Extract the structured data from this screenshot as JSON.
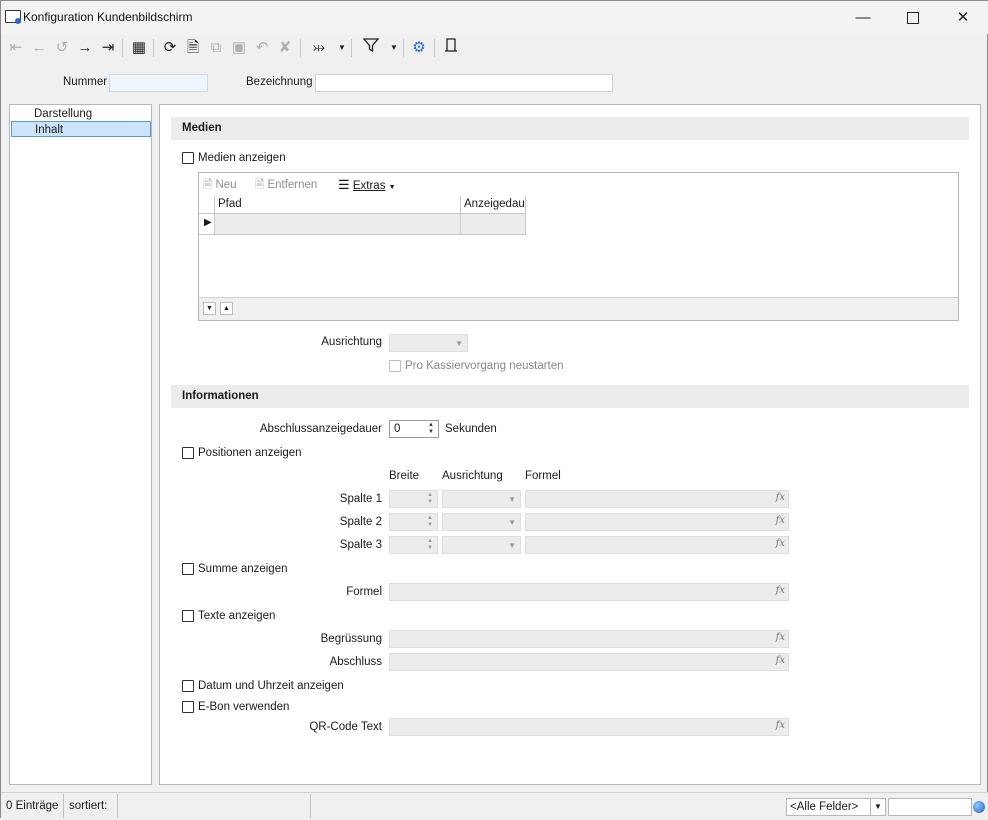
{
  "window": {
    "title": "Konfiguration Kundenbildschirm",
    "minimize_icon": "minimize-icon",
    "maximize_icon": "maximize-icon",
    "close_icon": "close-icon"
  },
  "toolbar": {
    "buttons": [
      {
        "icon": "first-record-icon",
        "enabled": false
      },
      {
        "icon": "back-icon",
        "enabled": false
      },
      {
        "icon": "history-icon",
        "enabled": false
      },
      {
        "icon": "forward-icon",
        "enabled": true
      },
      {
        "icon": "last-record-icon",
        "enabled": true
      },
      {
        "icon": "table-view-icon",
        "enabled": true
      },
      {
        "icon": "refresh-icon",
        "enabled": true
      },
      {
        "icon": "new-document-icon",
        "enabled": true
      },
      {
        "icon": "copy-icon",
        "enabled": false
      },
      {
        "icon": "save-icon",
        "enabled": false
      },
      {
        "icon": "undo-icon",
        "enabled": false
      },
      {
        "icon": "delete-icon",
        "enabled": false
      },
      {
        "icon": "pin-icon",
        "enabled": true
      },
      {
        "icon": "filter-icon",
        "enabled": true
      },
      {
        "icon": "settings-icon",
        "enabled": true
      },
      {
        "icon": "exit-icon",
        "enabled": true
      }
    ]
  },
  "header": {
    "nummer_label": "Nummer",
    "nummer_value": "",
    "bezeichnung_label": "Bezeichnung",
    "bezeichnung_value": ""
  },
  "nav": {
    "items": [
      {
        "label": "Darstellung",
        "selected": false
      },
      {
        "label": "Inhalt",
        "selected": true
      }
    ]
  },
  "medien": {
    "section_title": "Medien",
    "show_label": "Medien anzeigen",
    "show_checked": false,
    "grid": {
      "new_label": "Neu",
      "remove_label": "Entfernen",
      "extras_label": "Extras",
      "columns": [
        "Pfad",
        "Anzeigedau"
      ]
    },
    "ausrichtung_label": "Ausrichtung",
    "ausrichtung_value": "",
    "restart_label": "Pro Kassiervorgang neustarten",
    "restart_checked": false
  },
  "informationen": {
    "section_title": "Informationen",
    "abschluss_label": "Abschlussanzeigedauer",
    "abschluss_value": "0",
    "abschluss_unit": "Sekunden",
    "positionen_label": "Positionen anzeigen",
    "positionen_checked": false,
    "col_breite": "Breite",
    "col_ausrichtung": "Ausrichtung",
    "col_formel": "Formel",
    "spalten": [
      {
        "label": "Spalte 1",
        "breite": "",
        "ausrichtung": "",
        "formel": ""
      },
      {
        "label": "Spalte 2",
        "breite": "",
        "ausrichtung": "",
        "formel": ""
      },
      {
        "label": "Spalte 3",
        "breite": "",
        "ausrichtung": "",
        "formel": ""
      }
    ],
    "summe_label": "Summe anzeigen",
    "summe_checked": false,
    "formel_label": "Formel",
    "formel_value": "",
    "texte_label": "Texte anzeigen",
    "texte_checked": false,
    "begruessung_label": "Begrüssung",
    "begruessung_value": "",
    "abschluss_text_label": "Abschluss",
    "abschluss_text_value": "",
    "datum_label": "Datum und Uhrzeit anzeigen",
    "datum_checked": false,
    "ebon_label": "E-Bon verwenden",
    "ebon_checked": false,
    "qr_label": "QR-Code Text",
    "qr_value": "",
    "fx_symbol": "fx"
  },
  "statusbar": {
    "count": "0 Einträge",
    "sorted": "sortiert:",
    "field_filter": "<Alle Felder>",
    "search_value": ""
  }
}
